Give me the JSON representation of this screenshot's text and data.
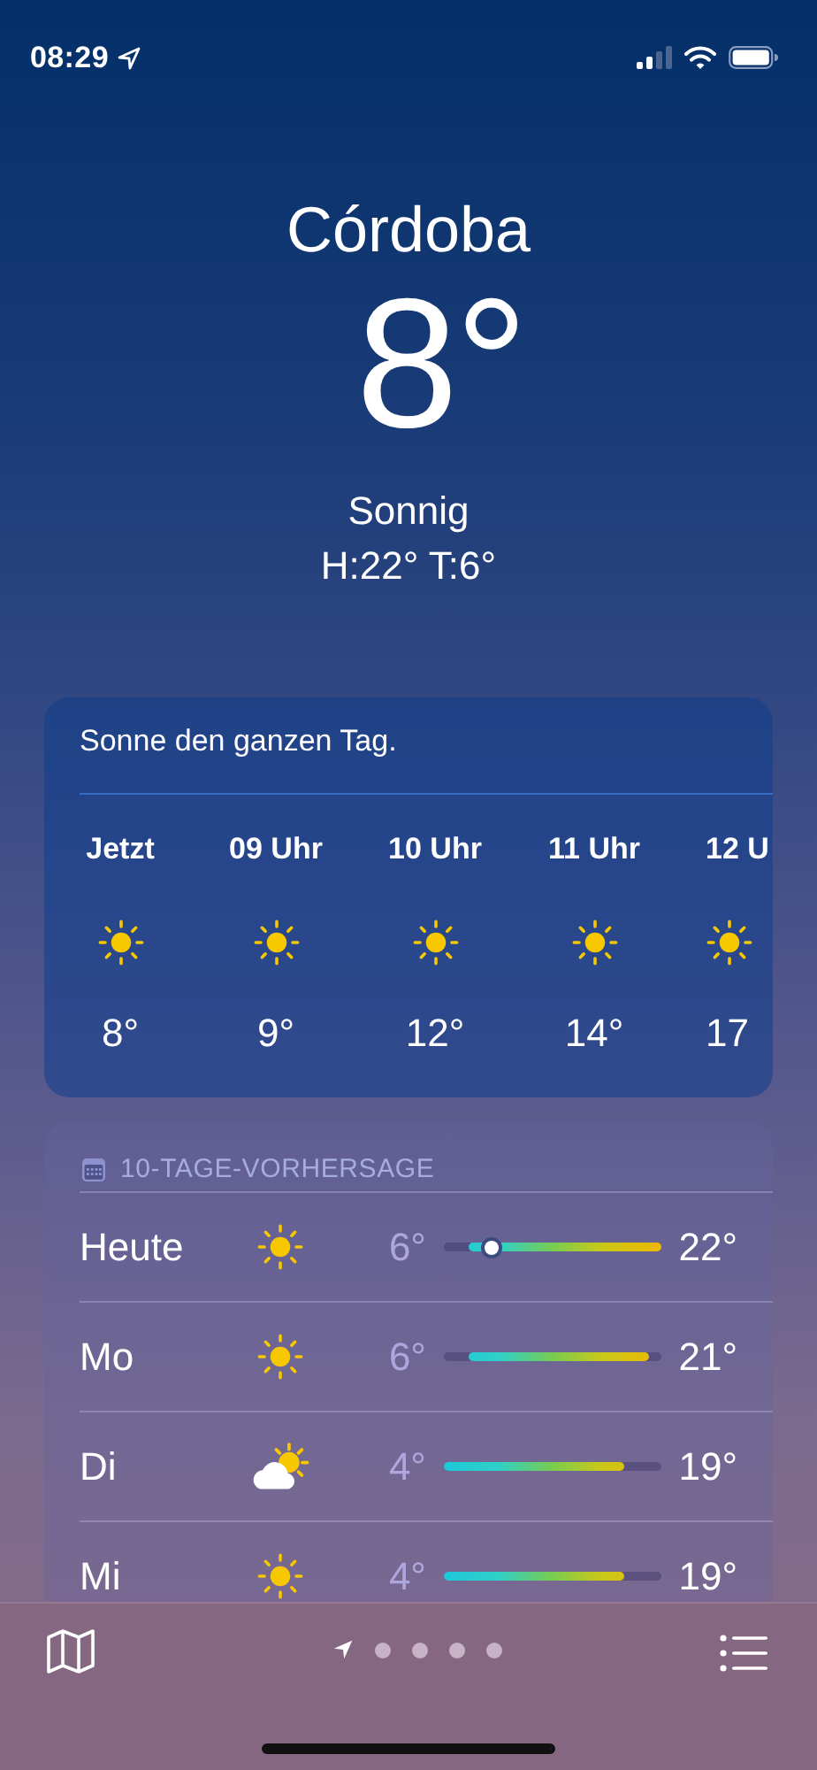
{
  "status_bar": {
    "time": "08:29",
    "location_active": true
  },
  "header": {
    "city": "Córdoba",
    "temperature": "8°",
    "condition": "Sonnig",
    "high_low": "H:22°  T:6°"
  },
  "hourly": {
    "summary": "Sonne den ganzen Tag.",
    "hours": [
      {
        "label": "Jetzt",
        "kind": "sun",
        "temp": "8°"
      },
      {
        "label": "09 Uhr",
        "kind": "sun",
        "temp": "9°"
      },
      {
        "label": "10 Uhr",
        "kind": "sun",
        "temp": "12°"
      },
      {
        "label": "11 Uhr",
        "kind": "sun",
        "temp": "14°"
      },
      {
        "label": "12 U",
        "kind": "sun",
        "temp": "17"
      }
    ]
  },
  "daily": {
    "title": "10-TAGE-VORHERSAGE",
    "days": [
      {
        "day": "Heute",
        "kind": "sun",
        "low": "6°",
        "high": "22°",
        "now_marker": true
      },
      {
        "day": "Mo",
        "kind": "sun",
        "low": "6°",
        "high": "21°",
        "now_marker": false
      },
      {
        "day": "Di",
        "kind": "partly_cloudy",
        "low": "4°",
        "high": "19°",
        "now_marker": false
      },
      {
        "day": "Mi",
        "kind": "sun",
        "low": "4°",
        "high": "19°",
        "now_marker": false
      }
    ]
  },
  "tab_bar": {
    "pages": [
      {
        "kind": "location",
        "selected": true
      },
      {
        "kind": "dot",
        "selected": false
      },
      {
        "kind": "dot",
        "selected": false
      },
      {
        "kind": "dot",
        "selected": false
      },
      {
        "kind": "dot",
        "selected": false
      }
    ]
  }
}
